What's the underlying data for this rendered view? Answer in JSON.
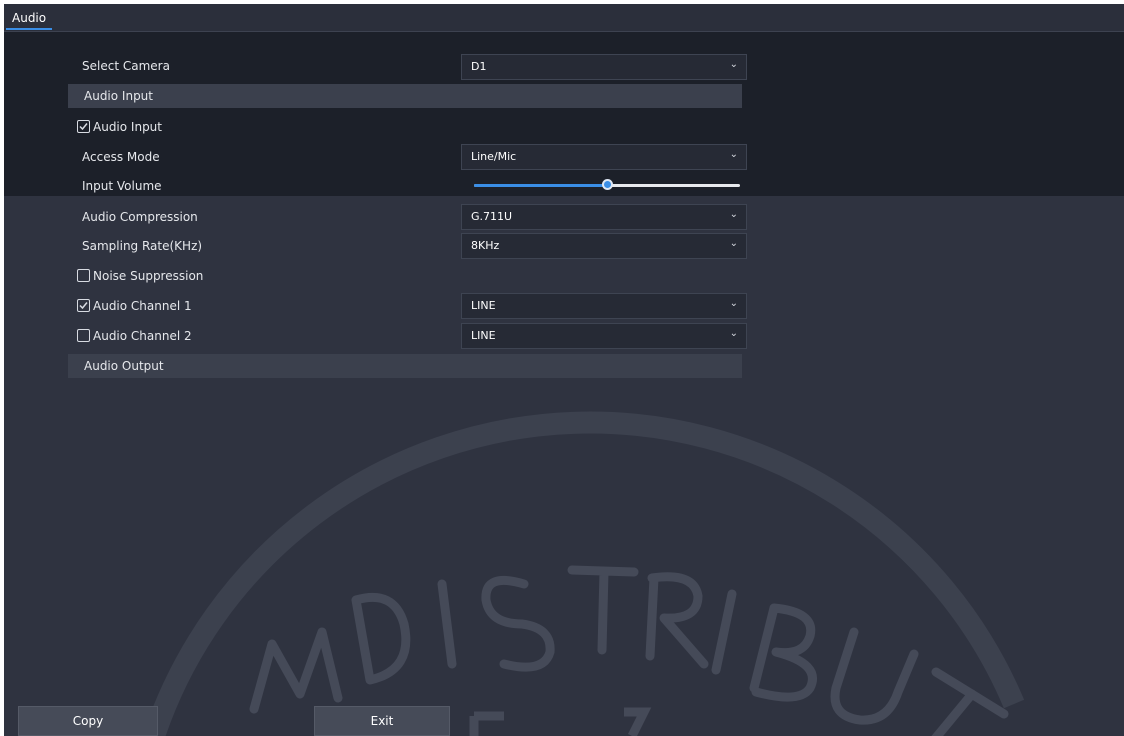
{
  "tabs": [
    {
      "label": "Audio"
    }
  ],
  "fields": {
    "select_camera": {
      "label": "Select Camera",
      "value": "D1"
    },
    "access_mode": {
      "label": "Access Mode",
      "value": "Line/Mic"
    },
    "input_volume": {
      "label": "Input Volume",
      "level_fraction": 0.5
    },
    "audio_compression": {
      "label": "Audio Compression",
      "value": "G.711U"
    },
    "sampling_rate": {
      "label": "Sampling Rate(KHz)",
      "value": "8KHz"
    }
  },
  "sections": {
    "audio_input": "Audio Input",
    "audio_output": "Audio Output"
  },
  "checkboxes": {
    "audio_input": {
      "label": "Audio Input",
      "checked": true
    },
    "noise_suppression": {
      "label": "Noise Suppression",
      "checked": false
    },
    "audio_channel_1": {
      "label": "Audio Channel 1",
      "checked": true,
      "value": "LINE"
    },
    "audio_channel_2": {
      "label": "Audio Channel 2",
      "checked": false,
      "value": "LINE"
    }
  },
  "buttons": {
    "copy": "Copy",
    "exit": "Exit"
  },
  "colors": {
    "accent": "#3a8ee6",
    "background": "#2f3340",
    "band": "#1c2029"
  }
}
